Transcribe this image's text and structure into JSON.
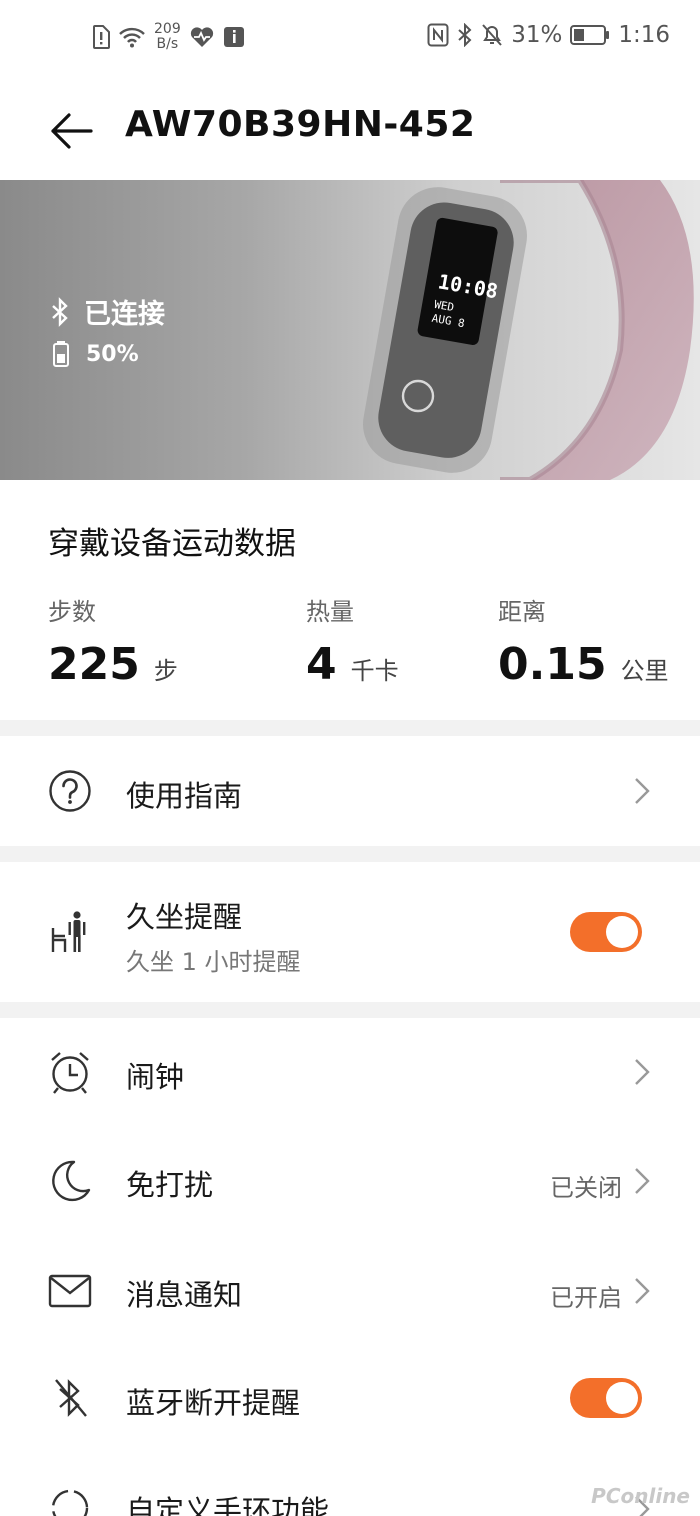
{
  "status_bar": {
    "net_speed_value": "209",
    "net_speed_unit": "B/s",
    "battery_percent": "31%",
    "time": "1:16"
  },
  "header": {
    "title": "AW70B39HN-452"
  },
  "banner": {
    "connection_status": "已连接",
    "battery": "50%",
    "watch_time": "10:08",
    "watch_day": "WED",
    "watch_date": "AUG 8"
  },
  "sport": {
    "title": "穿戴设备运动数据",
    "stats": [
      {
        "label": "步数",
        "value": "225",
        "unit": "步"
      },
      {
        "label": "热量",
        "value": "4",
        "unit": "千卡"
      },
      {
        "label": "距离",
        "value": "0.15",
        "unit": "公里"
      }
    ]
  },
  "menu": {
    "guide": {
      "label": "使用指南"
    },
    "sedentary": {
      "label": "久坐提醒",
      "sub": "久坐 1 小时提醒",
      "enabled": true
    },
    "alarm": {
      "label": "闹钟"
    },
    "dnd": {
      "label": "免打扰",
      "value": "已关闭"
    },
    "notify": {
      "label": "消息通知",
      "value": "已开启"
    },
    "bt_disconnect": {
      "label": "蓝牙断开提醒",
      "enabled": true
    },
    "custom": {
      "label": "自定义手环功能"
    }
  },
  "colors": {
    "accent": "#f36f2a"
  },
  "watermark": "PConline"
}
